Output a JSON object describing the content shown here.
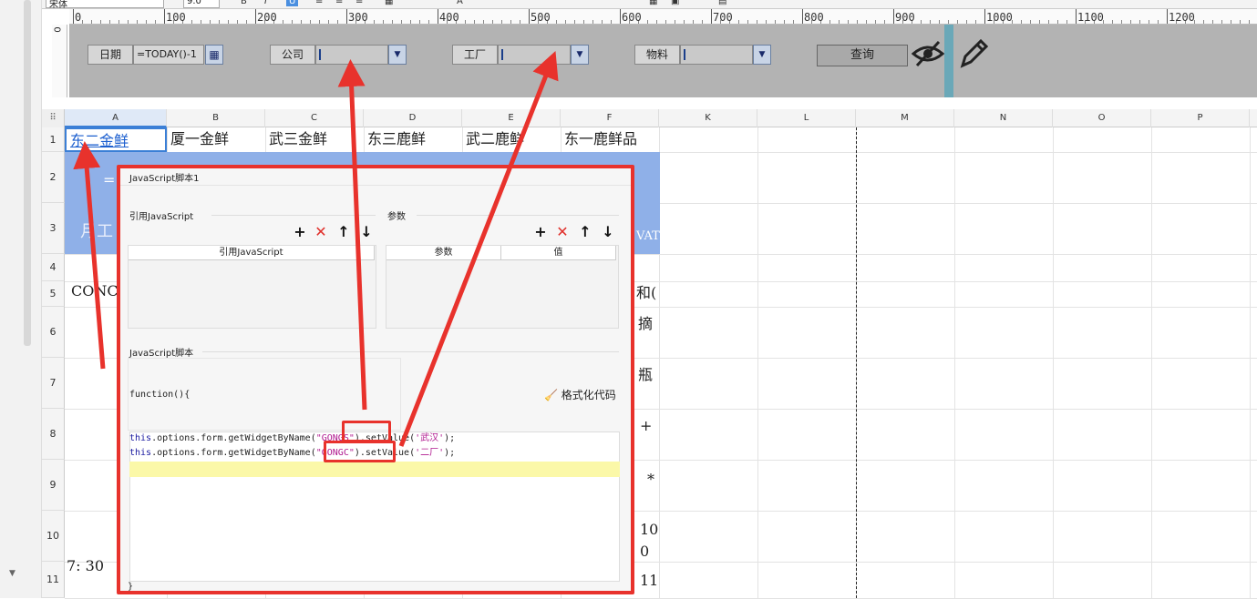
{
  "toolbar": {
    "font_name": "宋体",
    "font_size": "9.0"
  },
  "ruler": {
    "labels": [
      "0",
      "100",
      "200",
      "300",
      "400",
      "500",
      "600",
      "700",
      "800",
      "900",
      "1000",
      "1100",
      "1200"
    ]
  },
  "vruler_label": "0",
  "filters": [
    {
      "label": "日期",
      "value": "=TODAY()-1"
    },
    {
      "label": "公司",
      "value": ""
    },
    {
      "label": "工厂",
      "value": ""
    },
    {
      "label": "物料",
      "value": ""
    }
  ],
  "query_button": "查询",
  "columns": [
    "A",
    "B",
    "C",
    "D",
    "E",
    "F",
    "K",
    "L",
    "M",
    "N",
    "O",
    "P"
  ],
  "rows": [
    "1",
    "2",
    "3",
    "4",
    "5",
    "6",
    "7",
    "8",
    "9",
    "10",
    "11"
  ],
  "row1_cells": [
    "东二金鲜",
    "厦一金鲜",
    "武三金鲜",
    "东三鹿鲜",
    "武二鹿鲜",
    "东一鹿鲜品"
  ],
  "fragments": {
    "r2": "=",
    "r3": "月工",
    "r3r": "VAT",
    "r5": "CONCA",
    "r5r": "和(",
    "r6r": "摘",
    "r7r": "瓶",
    "r8r": "+",
    "r9r": "*",
    "r10a": "7: 30",
    "r10r": "10",
    "r10r2": "0",
    "r11r": "11"
  },
  "dialog": {
    "title": "JavaScript脚本1",
    "ref_section": "引用JavaScript",
    "param_section": "参数",
    "ref_header": "引用JavaScript",
    "param_headers": [
      "参数",
      "值"
    ],
    "script_section": "JavaScript脚本",
    "func_header": "function(){",
    "format_button": "格式化代码",
    "closing": "}",
    "code_lines": [
      {
        "kw": "this",
        "pre": ".options.form.getWidgetByName(",
        "str": "\"GONGS\"",
        "post": ").setValue(",
        "arg": "'武汉'",
        "end": ");"
      },
      {
        "kw": "this",
        "pre": ".options.form.getWidgetByName(",
        "str": "\"GONGC\"",
        "post": ").setValue(",
        "arg": "'二厂'",
        "end": ");"
      }
    ]
  },
  "accent_colors": {
    "annotation": "#e8322c",
    "header_band": "#8fb0e8",
    "panel": "#b3b3b3"
  }
}
